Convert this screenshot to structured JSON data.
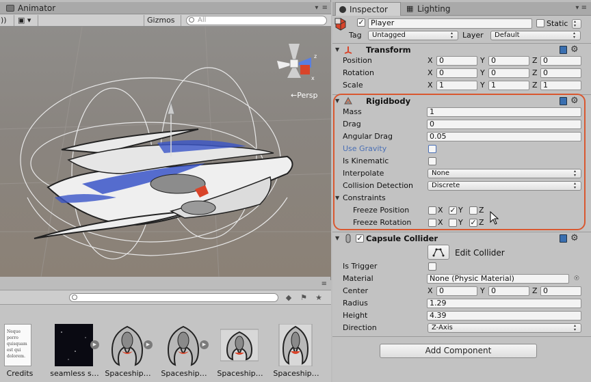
{
  "left_panel": {
    "tab_title": "Animator",
    "gizmos_label": "Gizmos",
    "scene_search_placeholder": "All",
    "persp_label": "←Persp",
    "assets": [
      {
        "label": "Credits",
        "kind": "document",
        "doc_text": "Neque porro quisquam est qui dolorem."
      },
      {
        "label": "seamless s…",
        "kind": "starfield"
      },
      {
        "label": "Spaceship…",
        "kind": "ship"
      },
      {
        "label": "Spaceship…",
        "kind": "ship"
      },
      {
        "label": "Spaceship…",
        "kind": "ship"
      },
      {
        "label": "Spaceship…",
        "kind": "ship"
      }
    ]
  },
  "inspector": {
    "tabs": [
      {
        "label": "Inspector"
      },
      {
        "label": "Lighting"
      }
    ],
    "object": {
      "name": "Player",
      "active": true,
      "static_label": "Static",
      "static_checked": false,
      "tag_label": "Tag",
      "tag_value": "Untagged",
      "layer_label": "Layer",
      "layer_value": "Default"
    },
    "transform": {
      "title": "Transform",
      "rows": [
        {
          "label": "Position",
          "x": "0",
          "y": "0",
          "z": "0"
        },
        {
          "label": "Rotation",
          "x": "0",
          "y": "0",
          "z": "0"
        },
        {
          "label": "Scale",
          "x": "1",
          "y": "1",
          "z": "1"
        }
      ]
    },
    "rigidbody": {
      "title": "Rigidbody",
      "mass_label": "Mass",
      "mass": "1",
      "drag_label": "Drag",
      "drag": "0",
      "angular_drag_label": "Angular Drag",
      "angular_drag": "0.05",
      "use_gravity_label": "Use Gravity",
      "use_gravity": false,
      "is_kinematic_label": "Is Kinematic",
      "is_kinematic": false,
      "interpolate_label": "Interpolate",
      "interpolate": "None",
      "collision_label": "Collision Detection",
      "collision": "Discrete",
      "constraints_label": "Constraints",
      "freeze_position_label": "Freeze Position",
      "freeze_position": {
        "x": false,
        "y": true,
        "z": false
      },
      "freeze_rotation_label": "Freeze Rotation",
      "freeze_rotation": {
        "x": false,
        "y": false,
        "z": true
      }
    },
    "capsule": {
      "title": "Capsule Collider",
      "enabled": true,
      "edit_label": "Edit Collider",
      "is_trigger_label": "Is Trigger",
      "is_trigger": false,
      "material_label": "Material",
      "material": "None (Physic Material)",
      "center_label": "Center",
      "center": {
        "x": "0",
        "y": "0",
        "z": "0"
      },
      "radius_label": "Radius",
      "radius": "1.29",
      "height_label": "Height",
      "height": "4.39",
      "direction_label": "Direction",
      "direction": "Z-Axis"
    },
    "add_component_label": "Add Component"
  },
  "colors": {
    "highlight": "#d9572f",
    "use_gravity_text": "#4a6fb5",
    "ship_blue": "#3a55c8"
  }
}
